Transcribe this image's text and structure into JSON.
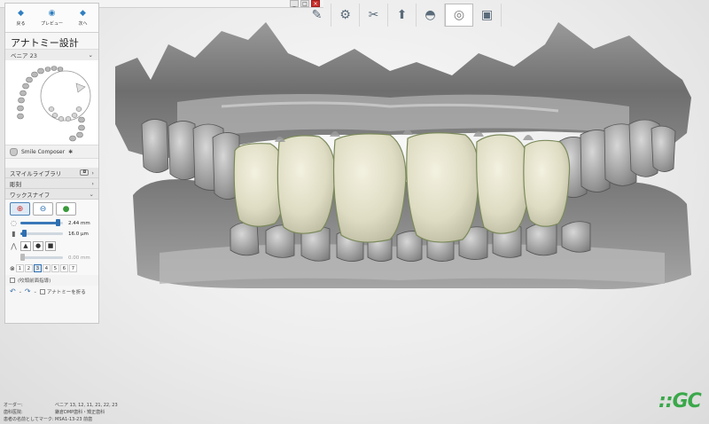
{
  "nav": {
    "back": "戻る",
    "preview": "プレビュー",
    "next": "次へ"
  },
  "panel": {
    "title": "アナトミー設計",
    "sub": "ベニア 23",
    "composer": "Smile Composer",
    "sections": {
      "smile_library": "スマイルライブラリ",
      "carve": "彫刻",
      "wax_knife": "ワックスナイフ"
    },
    "knife": {
      "size": "2.44 mm",
      "strength": "16.0 µm",
      "disabled_value": "0.00 mm",
      "levels": [
        "1",
        "2",
        "3",
        "4",
        "5",
        "6",
        "7"
      ],
      "active_level": "3"
    },
    "check_individual": "(咬頭前面指導)",
    "check_anatomy": "アナトミーを折る"
  },
  "window": {
    "buttons": [
      "_",
      "□",
      "×"
    ]
  },
  "info": {
    "rows": [
      {
        "label": "オーダー:",
        "value": "ベニア 13, 12, 11, 21, 22, 23"
      },
      {
        "label": "歯科医院:",
        "value": "鎌倉DMP歯科・矯正歯科"
      },
      {
        "label": "患者の名前としてマーク:",
        "value": "MSA1-13-23 前歯"
      }
    ]
  },
  "icons": {
    "tools": [
      "scalpel-icon",
      "scan-icon",
      "carve-icon",
      "upload-icon",
      "margin-icon",
      "tooth-icon",
      "crown-icon"
    ]
  },
  "logo": "::GC"
}
